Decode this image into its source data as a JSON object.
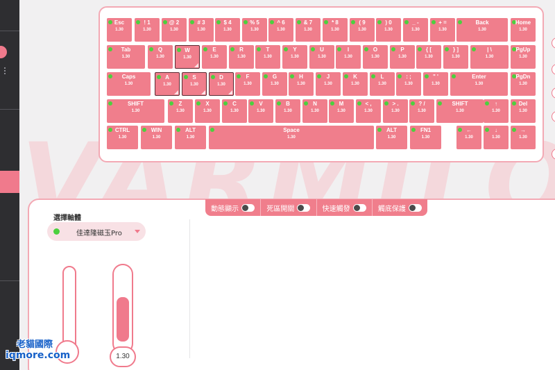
{
  "brand_watermark": "VARMILO",
  "colors": {
    "accent": "#f07e8c",
    "led": "#4cd03e",
    "sidebar": "#2e2e31"
  },
  "keyboard": {
    "rows": [
      [
        {
          "label": "Esc",
          "value": "1.30"
        },
        {
          "label": "! 1",
          "value": "1.30"
        },
        {
          "label": "@ 2",
          "value": "1.30"
        },
        {
          "label": "# 3",
          "value": "1.30"
        },
        {
          "label": "$ 4",
          "value": "1.30"
        },
        {
          "label": "% 5",
          "value": "1.30"
        },
        {
          "label": "^ 6",
          "value": "1.30"
        },
        {
          "label": "& 7",
          "value": "1.30"
        },
        {
          "label": "* 8",
          "value": "1.30"
        },
        {
          "label": "( 9",
          "value": "1.30"
        },
        {
          "label": ") 0",
          "value": "1.30"
        },
        {
          "label": "_ -",
          "value": "1.30"
        },
        {
          "label": "+ =",
          "value": "1.30"
        },
        {
          "label": "Back",
          "value": "1.30"
        },
        {
          "label": "Home",
          "value": "1.30"
        }
      ],
      [
        {
          "label": "Tab",
          "value": "1.30"
        },
        {
          "label": "Q",
          "value": "1.30"
        },
        {
          "label": "W",
          "value": "1.30"
        },
        {
          "label": "E",
          "value": "1.30"
        },
        {
          "label": "R",
          "value": "1.30"
        },
        {
          "label": "T",
          "value": "1.30"
        },
        {
          "label": "Y",
          "value": "1.30"
        },
        {
          "label": "U",
          "value": "1.30"
        },
        {
          "label": "I",
          "value": "1.30"
        },
        {
          "label": "O",
          "value": "1.30"
        },
        {
          "label": "P",
          "value": "1.30"
        },
        {
          "label": "{ [",
          "value": "1.30"
        },
        {
          "label": "} ]",
          "value": "1.30"
        },
        {
          "label": "| \\",
          "value": "1.30"
        },
        {
          "label": "PgUp",
          "value": "1.30"
        }
      ],
      [
        {
          "label": "Caps",
          "value": "1.30"
        },
        {
          "label": "A",
          "value": "1.30"
        },
        {
          "label": "S",
          "value": "1.30"
        },
        {
          "label": "D",
          "value": "1.30"
        },
        {
          "label": "F",
          "value": "1.30"
        },
        {
          "label": "G",
          "value": "1.30"
        },
        {
          "label": "H",
          "value": "1.30"
        },
        {
          "label": "J",
          "value": "1.30"
        },
        {
          "label": "K",
          "value": "1.30"
        },
        {
          "label": "L",
          "value": "1.30"
        },
        {
          "label": ": ;",
          "value": "1.30"
        },
        {
          "label": "\" '",
          "value": "1.30"
        },
        {
          "label": "Enter",
          "value": "1.30"
        },
        {
          "label": "PgDn",
          "value": "1.30"
        }
      ],
      [
        {
          "label": "SHIFT",
          "value": "1.30"
        },
        {
          "label": "Z",
          "value": "1.30"
        },
        {
          "label": "X",
          "value": "1.30"
        },
        {
          "label": "C",
          "value": "1.30"
        },
        {
          "label": "V",
          "value": "1.30"
        },
        {
          "label": "B",
          "value": "1.30"
        },
        {
          "label": "N",
          "value": "1.30"
        },
        {
          "label": "M",
          "value": "1.30"
        },
        {
          "label": "< ,",
          "value": "1.30"
        },
        {
          "label": "> .",
          "value": "1.30"
        },
        {
          "label": "? /",
          "value": "1.30"
        },
        {
          "label": "SHIFT",
          "value": "1.30"
        },
        {
          "label": "↑",
          "value": "1.30"
        },
        {
          "label": "Del",
          "value": "1.30"
        }
      ],
      [
        {
          "label": "CTRL",
          "value": "1.30"
        },
        {
          "label": "WIN",
          "value": "1.30"
        },
        {
          "label": "ALT",
          "value": "1.30"
        },
        {
          "label": "Space",
          "value": "1.30"
        },
        {
          "label": "ALT",
          "value": "1.30"
        },
        {
          "label": "FN1",
          "value": "1.30"
        },
        {
          "label": "←",
          "value": "1.30"
        },
        {
          "label": "↓",
          "value": "1.30"
        },
        {
          "label": "→",
          "value": "1.30"
        }
      ]
    ]
  },
  "toggles": [
    {
      "label": "動態顯示"
    },
    {
      "label": "死區開關"
    },
    {
      "label": "快速觸發"
    },
    {
      "label": "觸底保護"
    }
  ],
  "switch_panel": {
    "title": "選擇軸體",
    "selected": "佳達隆磁玉Pro",
    "travel_value": "1.30"
  },
  "watermark": {
    "line1": "老貓國際",
    "line2": "iqmore.com"
  }
}
